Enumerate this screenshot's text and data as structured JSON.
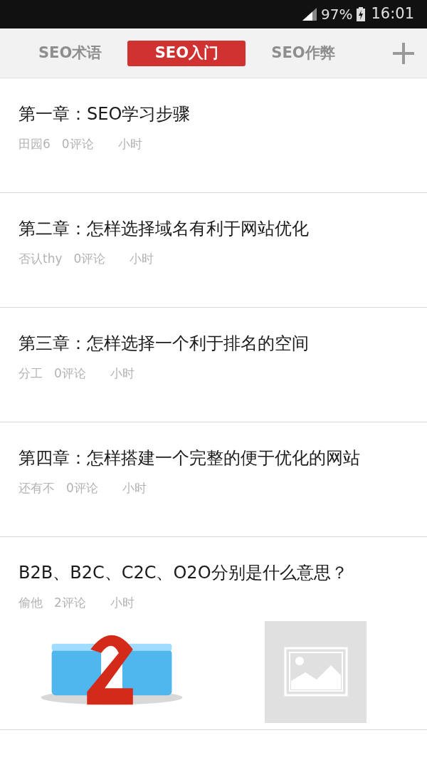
{
  "status_bar": {
    "battery": "97%",
    "time": "16:01"
  },
  "tabs": [
    {
      "label": "SEO术语",
      "selected": false
    },
    {
      "label": "SEO入门",
      "selected": true
    },
    {
      "label": "SEO作弊",
      "selected": false
    }
  ],
  "articles": [
    {
      "title": "第一章：SEO学习步骤",
      "author": "田园6",
      "comments": "0评论",
      "time": "小时"
    },
    {
      "title": "第二章：怎样选择域名有利于网站优化",
      "author": "否认thy",
      "comments": "0评论",
      "time": "小时"
    },
    {
      "title": "第三章：怎样选择一个利于排名的空间",
      "author": "分工",
      "comments": "0评论",
      "time": "小时"
    },
    {
      "title": "第四章：怎样搭建一个完整的便于优化的网站",
      "author": "还有不",
      "comments": "0评论",
      "time": "小时"
    },
    {
      "title": "B2B、B2C、C2C、O2O分别是什么意思？",
      "author": "偷他",
      "comments": "2评论",
      "time": "小时",
      "images": [
        {
          "kind": "picture"
        },
        {
          "kind": "placeholder"
        }
      ]
    }
  ]
}
